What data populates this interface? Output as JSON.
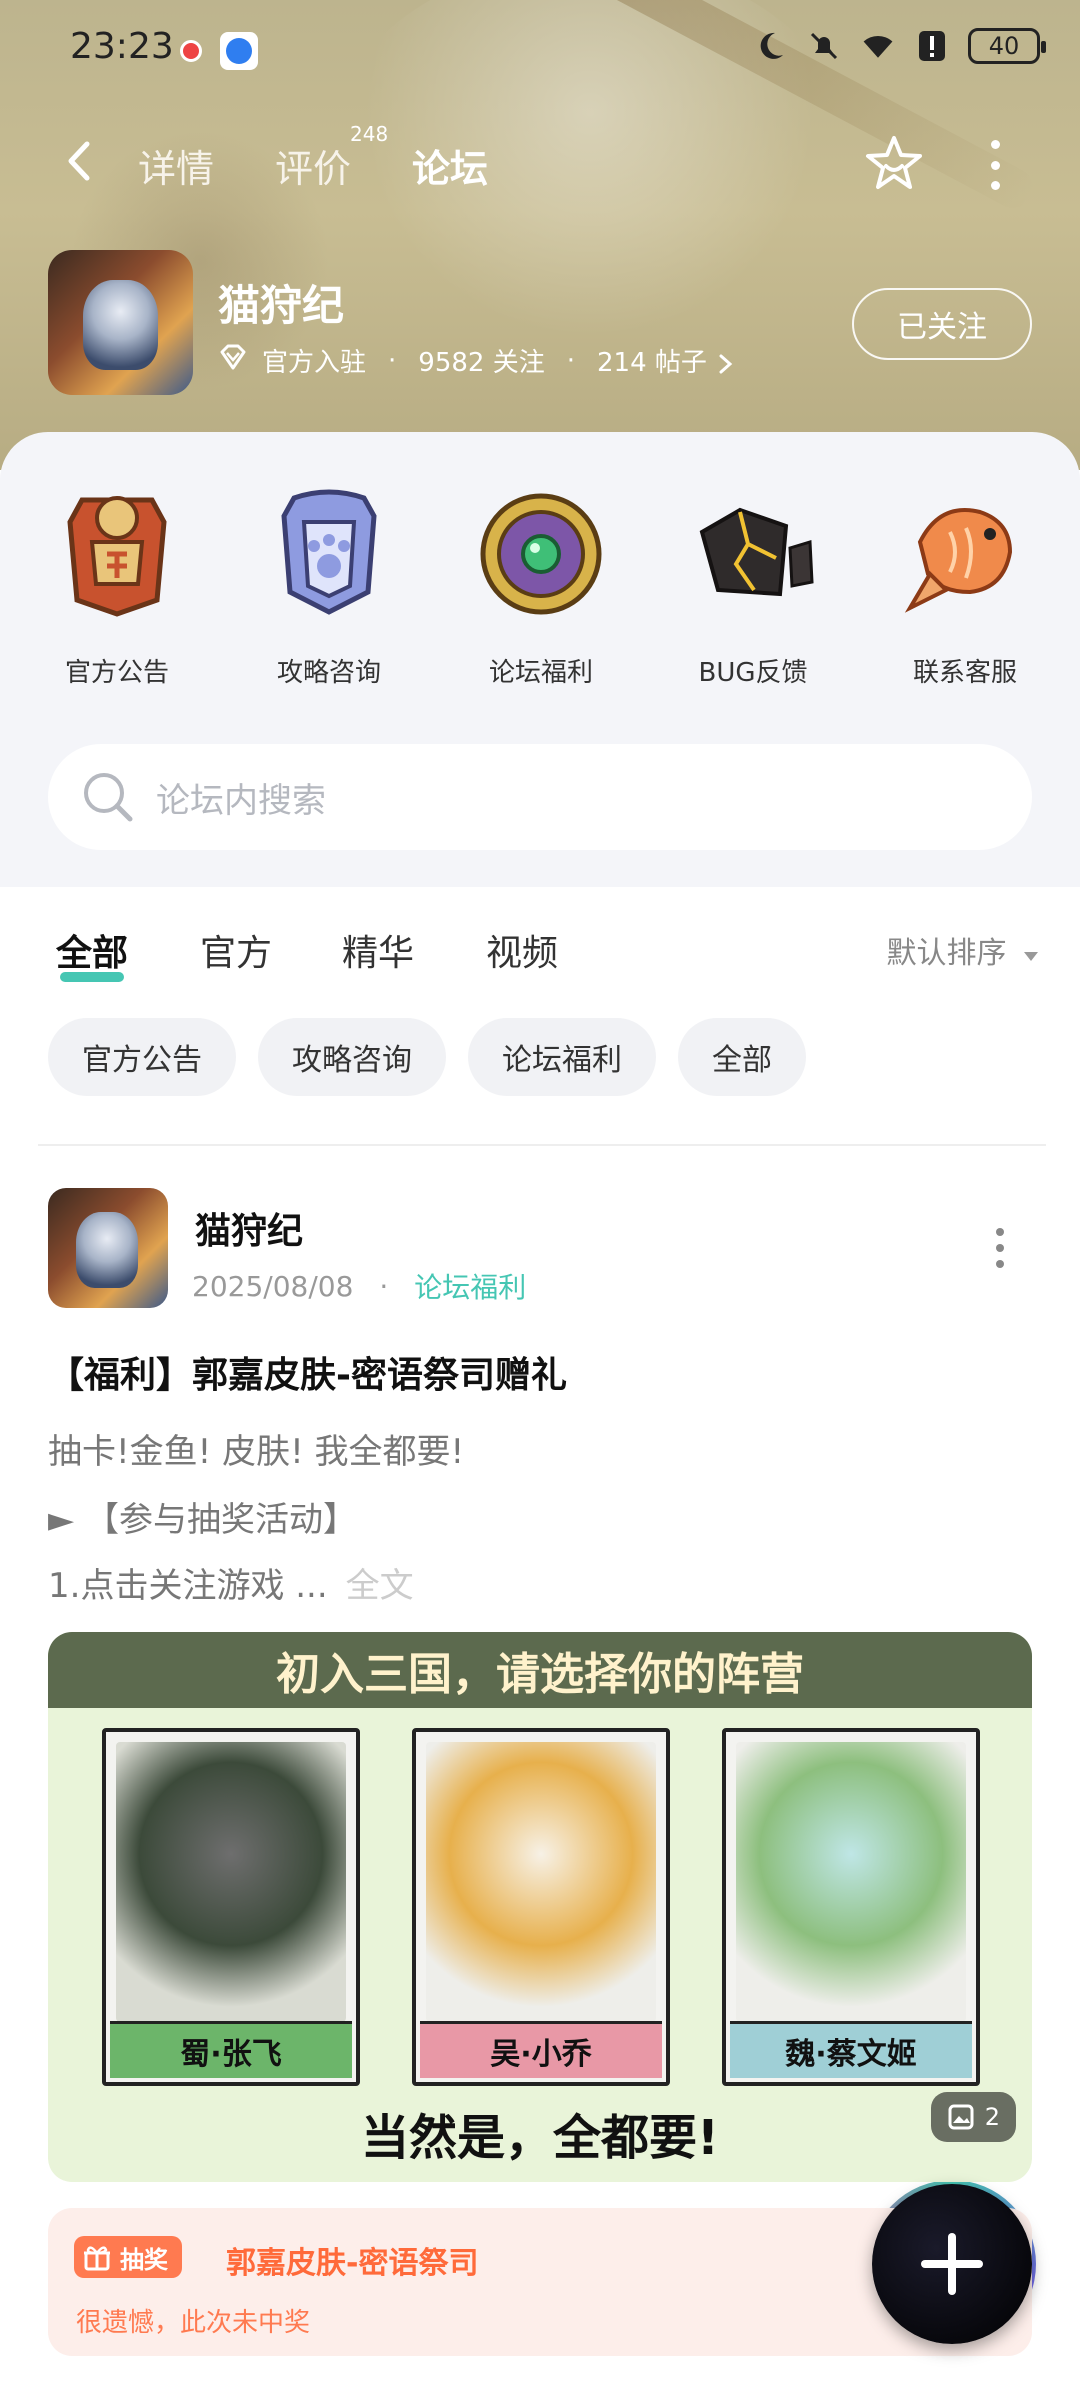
{
  "status_bar": {
    "time": "23:23",
    "battery": "40"
  },
  "nav": {
    "tabs": [
      {
        "label": "详情"
      },
      {
        "label": "评价",
        "badge": "248"
      },
      {
        "label": "论坛"
      }
    ]
  },
  "game": {
    "name": "猫狩纪",
    "official_label": "官方入驻",
    "followers": "9582 关注",
    "posts": "214 帖子",
    "follow_button": "已关注"
  },
  "quick_links": [
    {
      "label": "官方公告",
      "icon": "announcement-badge-icon"
    },
    {
      "label": "攻略咨询",
      "icon": "paw-badge-icon"
    },
    {
      "label": "论坛福利",
      "icon": "gem-medal-icon"
    },
    {
      "label": "BUG反馈",
      "icon": "cracked-stone-icon"
    },
    {
      "label": "联系客服",
      "icon": "koi-fish-icon"
    }
  ],
  "search": {
    "placeholder": "论坛内搜索"
  },
  "filter_tabs": [
    {
      "label": "全部"
    },
    {
      "label": "官方"
    },
    {
      "label": "精华"
    },
    {
      "label": "视频"
    }
  ],
  "sort_label": "默认排序",
  "chips": [
    "官方公告",
    "攻略咨询",
    "论坛福利",
    "全部"
  ],
  "post": {
    "author": "猫狩纪",
    "date": "2025/08/08",
    "dot": "·",
    "category": "论坛福利",
    "title": "【福利】郭嘉皮肤-密语祭司赠礼",
    "line1": "抽卡!金鱼! 皮肤! 我全都要!",
    "line2": "► 【参与抽奖活动】",
    "line3": "1.点击关注游戏 ...",
    "full_text": "全文",
    "image": {
      "banner": "初入三国，请选择你的阵营",
      "cards": [
        {
          "name": "蜀·张飞"
        },
        {
          "name": "吴·小乔"
        },
        {
          "name": "魏·蔡文姬"
        }
      ],
      "tagline": "当然是，全都要!",
      "count": "2"
    }
  },
  "lottery": {
    "badge": "抽奖",
    "title": "郭嘉皮肤-密语祭司",
    "result": "很遗憾，此次未中奖"
  },
  "colors": {
    "accent": "#45c6b3",
    "lottery": "#ff6a3a"
  }
}
